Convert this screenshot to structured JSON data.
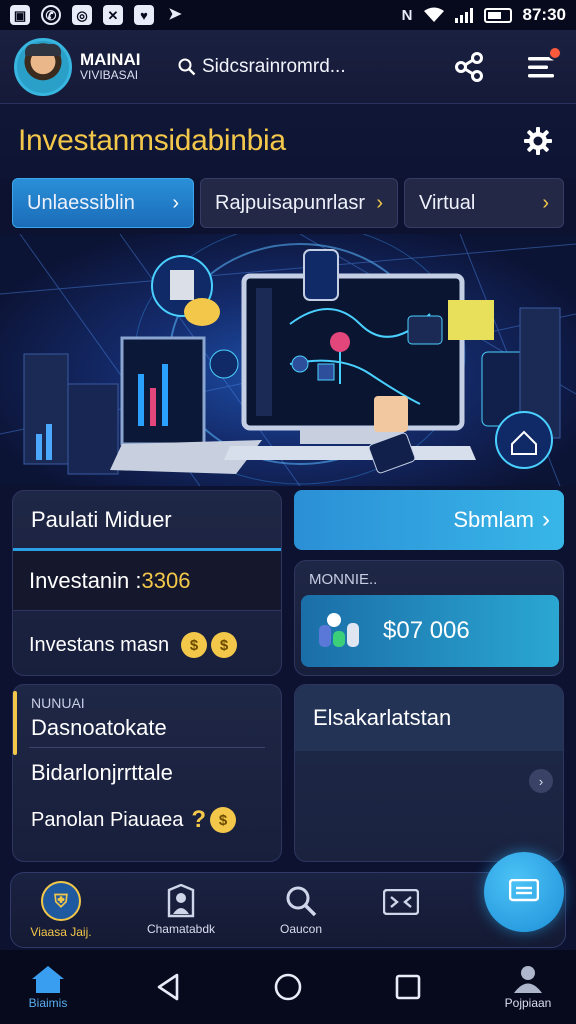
{
  "status_bar": {
    "time": "87:30",
    "left_icons": [
      "image-icon",
      "whatsapp-icon",
      "instagram-icon",
      "x-icon",
      "heart-icon",
      "send-icon"
    ],
    "right_icons": [
      "nfc-icon",
      "wifi-icon",
      "signal-icon",
      "battery-icon"
    ]
  },
  "header": {
    "brand_line1": "MAINAI",
    "brand_line2": "VIVIBASAI",
    "search_text": "Sidcsrainromrd...",
    "has_notification": true
  },
  "page": {
    "title": "Investanmsidabinbia"
  },
  "tabs": [
    {
      "label": "Unlaessiblin",
      "active": true
    },
    {
      "label": "Rajpuisapunrlasr",
      "active": false
    },
    {
      "label": "Virtual",
      "active": false
    }
  ],
  "cards": {
    "primary": {
      "title": "Paulati Miduer",
      "investment_label": "Investanin :",
      "investment_value": "3306",
      "summary_label": "Investans masn"
    },
    "submit_label": "Sbmlam",
    "money": {
      "label": "MONNIE..",
      "amount": "$07 006"
    },
    "notes": {
      "label": "NUNUAI",
      "line1": "Dasnoatokate",
      "line2": "Bidarlonjrrttale",
      "line3": "Panolan Piauaea"
    },
    "right_panel": {
      "title": "Elsakarlatstan"
    }
  },
  "bottom_nav": [
    {
      "label": "Viaasa Jaij.",
      "icon": "shield-icon",
      "active": true
    },
    {
      "label": "Chamatabdk",
      "icon": "user-badge-icon",
      "active": false
    },
    {
      "label": "Oaucon",
      "icon": "search-icon",
      "active": false
    },
    {
      "label": "",
      "icon": "ticket-icon",
      "active": false
    }
  ],
  "system_nav": {
    "home_label": "Biaimis",
    "profile_label": "Pojpiaan"
  },
  "colors": {
    "accent_blue": "#2a8fd8",
    "accent_gold": "#f3c84a",
    "background": "#0d1230"
  }
}
